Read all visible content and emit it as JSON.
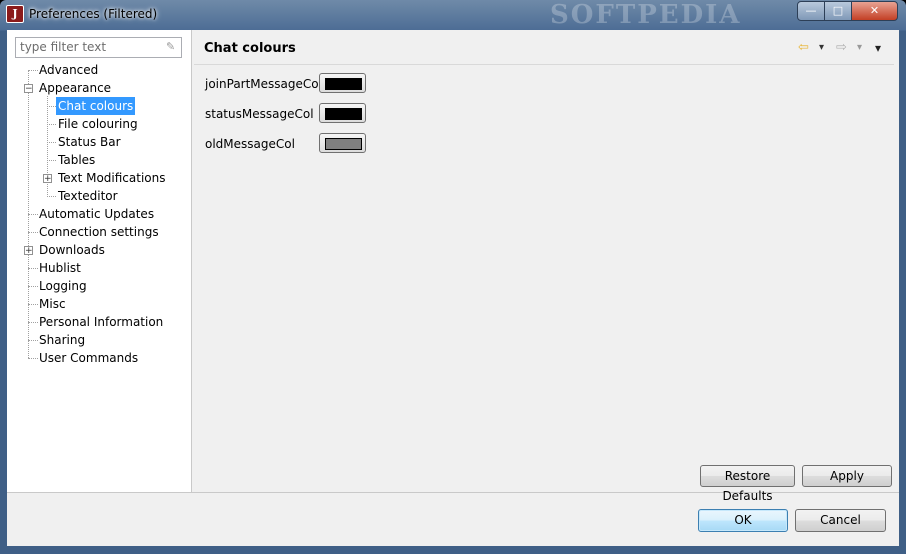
{
  "window": {
    "title": "Preferences (Filtered)",
    "watermark": "SOFTPEDIA",
    "app_icon_letter": "J"
  },
  "titlebar_buttons": {
    "minimize": "—",
    "maximize": "□",
    "close": "✕"
  },
  "filter": {
    "placeholder": "type filter text"
  },
  "tree": {
    "items": [
      {
        "label": "Advanced"
      },
      {
        "label": "Appearance",
        "expanded": true
      },
      {
        "label": "Chat colours",
        "selected": true
      },
      {
        "label": "File colouring"
      },
      {
        "label": "Status Bar"
      },
      {
        "label": "Tables"
      },
      {
        "label": "Text Modifications",
        "expandable": true
      },
      {
        "label": "Texteditor"
      },
      {
        "label": "Automatic Updates"
      },
      {
        "label": "Connection settings"
      },
      {
        "label": "Downloads",
        "expandable": true
      },
      {
        "label": "Hublist"
      },
      {
        "label": "Logging"
      },
      {
        "label": "Misc"
      },
      {
        "label": "Personal Information"
      },
      {
        "label": "Sharing"
      },
      {
        "label": "User Commands"
      }
    ]
  },
  "page": {
    "title": "Chat colours",
    "nav": {
      "back": "⇦",
      "back_menu": "▾",
      "forward": "⇨",
      "forward_menu": "▾",
      "view_menu": "▾"
    },
    "fields": [
      {
        "label": "joinPartMessageCol",
        "color": "#000000"
      },
      {
        "label": "statusMessageCol",
        "color": "#000000"
      },
      {
        "label": "oldMessageCol",
        "color": "#808080"
      }
    ],
    "restore_defaults": "Restore Defaults",
    "apply": "Apply"
  },
  "footer": {
    "ok": "OK",
    "cancel": "Cancel"
  },
  "colors": {
    "selection": "#3399ff",
    "back_arrow": "#e8b534",
    "forward_arrow": "#b0b0b0"
  }
}
